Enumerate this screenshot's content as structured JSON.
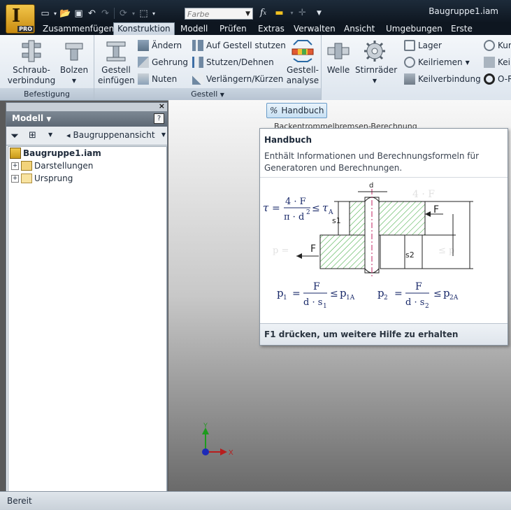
{
  "app": {
    "logo_letter": "I",
    "logo_badge": "PRO",
    "document_title": "Baugruppe1.iam"
  },
  "quick_access": {
    "color_placeholder": "Farbe",
    "icons": [
      "new-icon",
      "open-icon",
      "save-icon",
      "undo-icon",
      "redo-icon",
      "update-icon",
      "select-icon",
      "fx-icon",
      "measure-icon"
    ]
  },
  "tabs": [
    {
      "label": "Zusammenfügen"
    },
    {
      "label": "Konstruktion",
      "active": true
    },
    {
      "label": "Modell"
    },
    {
      "label": "Prüfen"
    },
    {
      "label": "Extras"
    },
    {
      "label": "Verwalten"
    },
    {
      "label": "Ansicht"
    },
    {
      "label": "Umgebungen"
    },
    {
      "label": "Erste Schritte"
    }
  ],
  "ribbon": {
    "befestigung": {
      "title": "Befestigung",
      "schraub_line1": "Schraub-",
      "schraub_line2": "verbindung",
      "bolzen": "Bolzen"
    },
    "gestell": {
      "title": "Gestell",
      "einfuegen_line1": "Gestell",
      "einfuegen_line2": "einfügen",
      "aendern": "Ändern",
      "gehrung": "Gehrung",
      "nuten": "Nuten",
      "auf_gestell": "Auf Gestell stutzen",
      "stutzen": "Stutzen/Dehnen",
      "verlaengern": "Verlängern/Kürzen",
      "analyse_line1": "Gestell-",
      "analyse_line2": "analyse"
    },
    "antrieb": {
      "welle": "Welle",
      "stirnraeder": "Stirnräder",
      "lager": "Lager",
      "keilriemen": "Keilriemen",
      "keilverbindung": "Keilverbindung",
      "kur": "Kur",
      "kei": "Kei",
      "o_ri": "O-R"
    }
  },
  "browser": {
    "title": "Modell",
    "view_label": "Baugruppenansicht",
    "tree": [
      {
        "label": "Baugruppe1.iam",
        "level": 0
      },
      {
        "label": "Darstellungen",
        "level": 1
      },
      {
        "label": "Ursprung",
        "level": 1
      }
    ]
  },
  "hint": {
    "button_label": "Handbuch",
    "behind_text": "Backentrommelbremsen-Berechnung",
    "tooltip_title": "Handbuch",
    "tooltip_desc": "Enthält Informationen und Berechnungsformeln für Generatoren und Berechnungen.",
    "tooltip_footer": "F1 drücken, um weitere Hilfe zu erhalten",
    "formula": {
      "tau": "τ",
      "eq": "=",
      "num1": "4 · F",
      "den1": "π · d",
      "exp": "2",
      "le": "≤",
      "tau_a": "τ",
      "tau_a_sub": "A",
      "p1": "p",
      "p1_sub": "1",
      "p1_num": "F",
      "p1_den": "d · s",
      "p1_den_sub": "1",
      "p1a": "p",
      "p1a_sub": "1A",
      "p2": "p",
      "p2_sub": "2",
      "p2_num": "F",
      "p2_den": "d · s",
      "p2_den_sub": "2",
      "p2a": "p",
      "p2a_sub": "2A",
      "label_F": "F",
      "label_d": "d",
      "label_s1": "s1",
      "label_s2": "s2"
    }
  },
  "canvas": {
    "axis_y": "Y",
    "axis_x": "X"
  },
  "status": {
    "text": "Bereit"
  }
}
